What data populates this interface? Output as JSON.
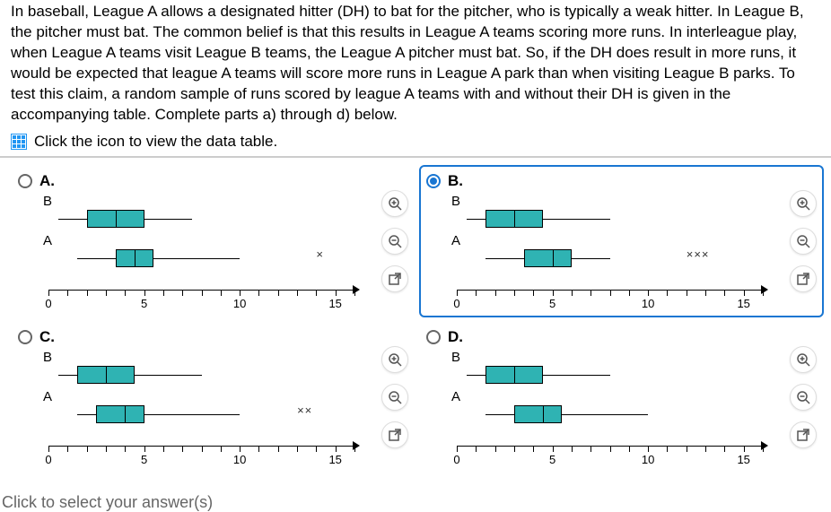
{
  "question_text": "In baseball, League A allows a designated hitter (DH) to bat for the pitcher, who is typically a weak hitter. In League B, the pitcher must bat. The common belief is that this results in League A teams scoring more runs. In interleague play, when League A teams visit League B teams, the League A pitcher must bat. So, if the DH does result in more runs, it would be expected that league A teams will score more runs in League A park than when visiting League B parks. To test this claim, a random sample of runs scored by league A teams with and without their DH is given in the accompanying table. Complete parts a) through d) below.",
  "icon_link_text": "Click the icon to view the data table.",
  "footer_text": "Click to select your answer(s)",
  "selected": "B",
  "choices": [
    "A",
    "B",
    "C",
    "D"
  ],
  "labels": {
    "A": "A.",
    "B": "B.",
    "C": "C.",
    "D": "D."
  },
  "chart_data": [
    {
      "id": "A",
      "xrange": [
        0,
        16
      ],
      "ticks": [
        0,
        5,
        10,
        15
      ],
      "series": [
        {
          "name": "B",
          "min": 0.5,
          "q1": 2,
          "med": 3.5,
          "q3": 5,
          "max": 7.5,
          "outliers": []
        },
        {
          "name": "A",
          "min": 1.5,
          "q1": 3.5,
          "med": 4.5,
          "q3": 5.5,
          "max": 10,
          "outliers": [
            14
          ]
        }
      ]
    },
    {
      "id": "B",
      "xrange": [
        0,
        16
      ],
      "ticks": [
        0,
        5,
        10,
        15
      ],
      "series": [
        {
          "name": "B",
          "min": 0.5,
          "q1": 1.5,
          "med": 3,
          "q3": 4.5,
          "max": 8,
          "outliers": []
        },
        {
          "name": "A",
          "min": 1.5,
          "q1": 3.5,
          "med": 5,
          "q3": 6,
          "max": 8,
          "outliers": [
            12,
            12.8,
            13.6
          ]
        }
      ]
    },
    {
      "id": "C",
      "xrange": [
        0,
        16
      ],
      "ticks": [
        0,
        5,
        10,
        15
      ],
      "series": [
        {
          "name": "B",
          "min": 0.5,
          "q1": 1.5,
          "med": 3,
          "q3": 4.5,
          "max": 8,
          "outliers": []
        },
        {
          "name": "A",
          "min": 1.5,
          "q1": 2.5,
          "med": 4,
          "q3": 5,
          "max": 10,
          "outliers": [
            13,
            13.8
          ]
        }
      ]
    },
    {
      "id": "D",
      "xrange": [
        0,
        16
      ],
      "ticks": [
        0,
        5,
        10,
        15
      ],
      "series": [
        {
          "name": "B",
          "min": 0.5,
          "q1": 1.5,
          "med": 3,
          "q3": 4.5,
          "max": 8,
          "outliers": []
        },
        {
          "name": "A",
          "min": 1.5,
          "q1": 3,
          "med": 4.5,
          "q3": 5.5,
          "max": 10,
          "outliers": []
        }
      ]
    }
  ]
}
